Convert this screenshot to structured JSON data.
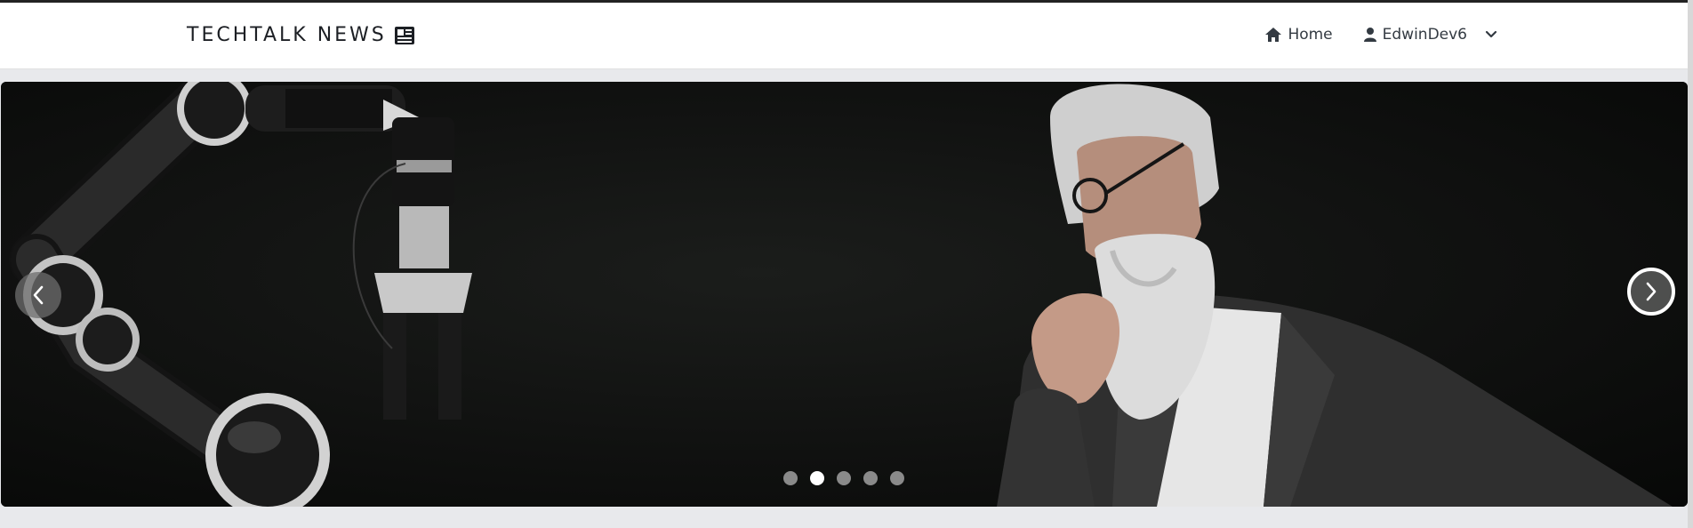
{
  "navbar": {
    "brand": "TECHTALK NEWS",
    "brand_icon": "newspaper-icon",
    "home_label": "Home",
    "home_icon": "home-icon",
    "user_label": "EdwinDev6",
    "user_icon": "user-icon",
    "dropdown_icon": "chevron-down-icon"
  },
  "carousel": {
    "slide_count": 5,
    "active_slide": 2,
    "prev_icon": "chevron-left-icon",
    "next_icon": "chevron-right-icon"
  },
  "colors": {
    "navbar_bg": "#ffffff",
    "page_bg": "#e8e9ec",
    "slide_bg": "#0d0e0d",
    "indicator": "#8a8a8a",
    "indicator_active": "#ffffff"
  }
}
